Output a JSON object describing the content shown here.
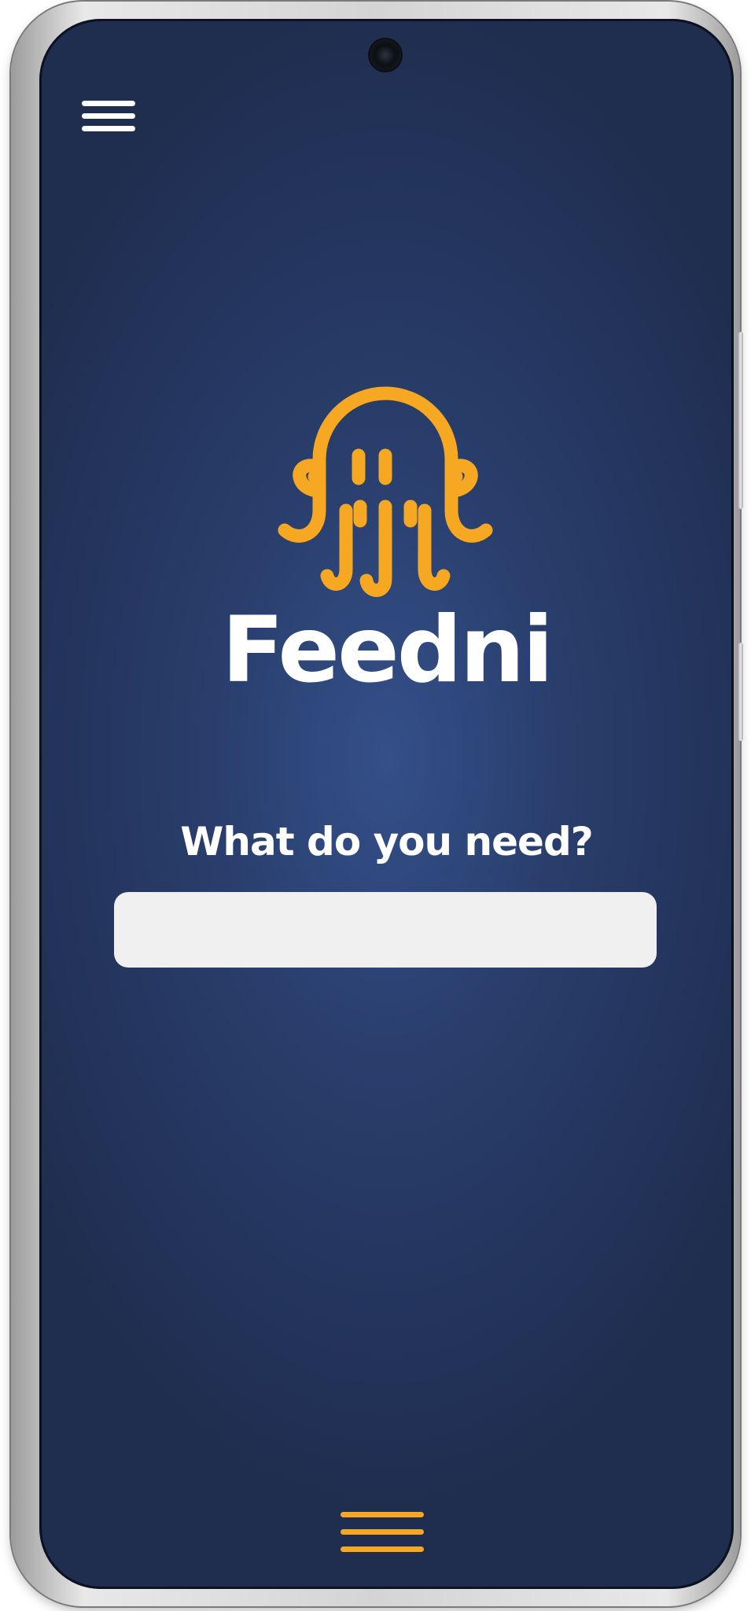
{
  "app": {
    "name": "Feedni",
    "logo_icon": "octopus-logo-icon",
    "accent_color": "#f7a823",
    "background_color": "#1f2d4f"
  },
  "top_bar": {
    "menu_icon": "hamburger-menu-icon"
  },
  "main": {
    "prompt": "What do you need?",
    "search": {
      "value": "",
      "placeholder": ""
    }
  },
  "bottom_bar": {
    "menu_icon": "hamburger-menu-icon"
  }
}
